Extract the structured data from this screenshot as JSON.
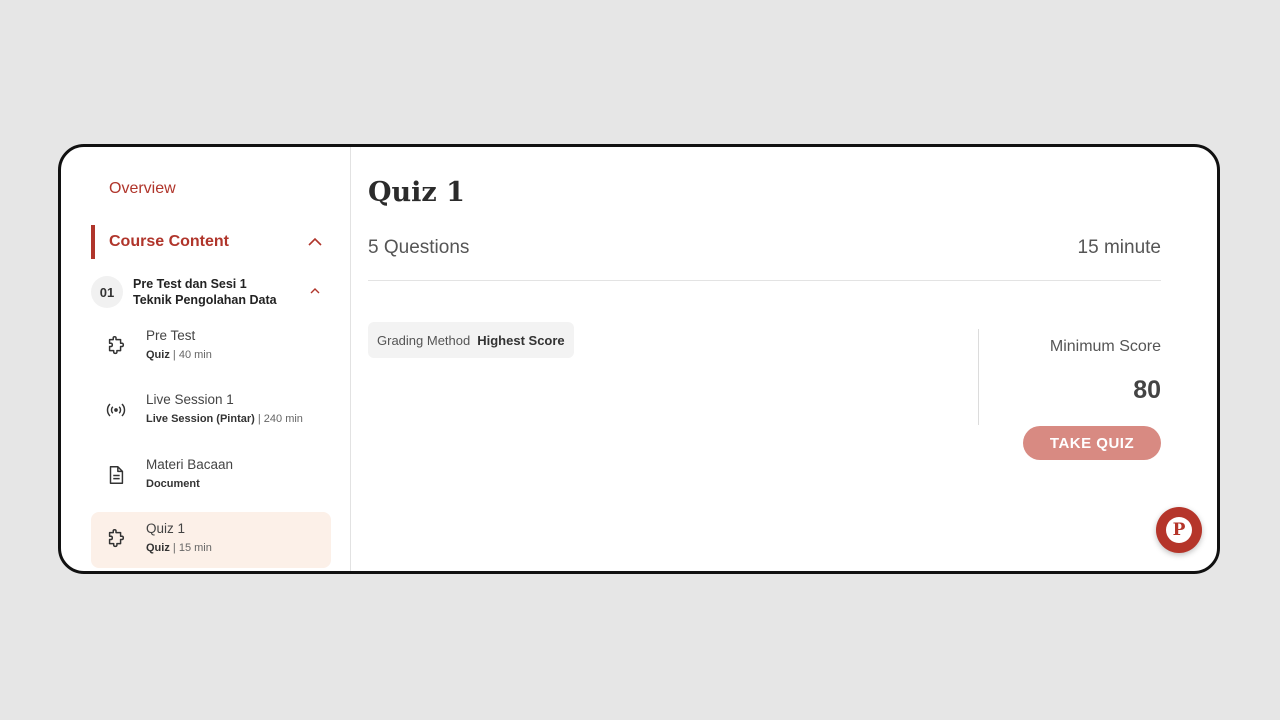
{
  "sidebar": {
    "overview_label": "Overview",
    "course_content_label": "Course Content",
    "section": {
      "number": "01",
      "title_line1": "Pre Test dan Sesi 1",
      "title_line2": "Teknik Pengolahan Data"
    },
    "items": [
      {
        "title": "Pre Test",
        "type": "Quiz",
        "duration": "| 40 min",
        "icon": "puzzle-icon",
        "active": false
      },
      {
        "title": "Live Session 1",
        "type": "Live Session (Pintar)",
        "duration": "| 240 min",
        "icon": "broadcast-icon",
        "active": false
      },
      {
        "title": "Materi Bacaan",
        "type": "Document",
        "duration": "",
        "icon": "document-icon",
        "active": false
      },
      {
        "title": "Quiz 1",
        "type": "Quiz",
        "duration": "| 15 min",
        "icon": "puzzle-icon",
        "active": true
      }
    ]
  },
  "main": {
    "title": "Quiz 1",
    "questions": "5 Questions",
    "duration": "15 minute",
    "grading_label": "Grading Method",
    "grading_value": "Highest Score",
    "min_score_label": "Minimum Score",
    "min_score_value": "80",
    "take_quiz_label": "TAKE QUIZ"
  },
  "fab": {
    "letter": "P",
    "icon": "pintar-logo-icon"
  },
  "colors": {
    "accent": "#b0352b",
    "button": "#d88a82",
    "active_bg": "#fcf0e8",
    "background": "#e6e6e6"
  }
}
